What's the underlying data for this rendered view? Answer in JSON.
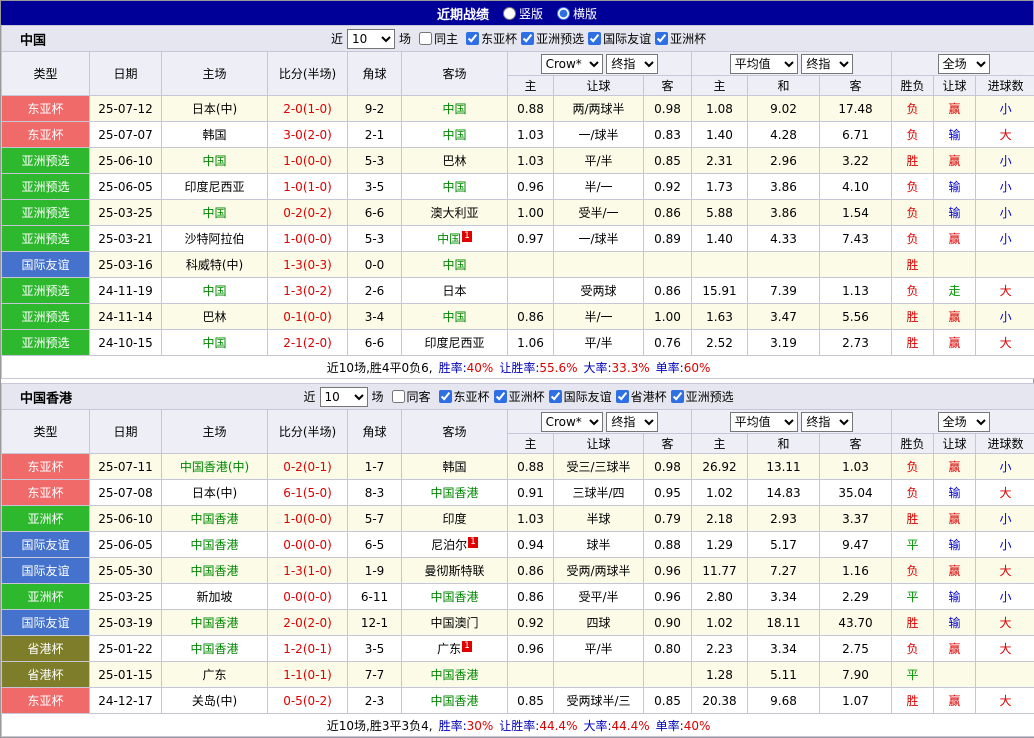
{
  "topbar": {
    "title": "近期战绩",
    "radio_vertical": "竖版",
    "radio_horizontal": "横版",
    "selected": "横版"
  },
  "columns": {
    "type": "类型",
    "date": "日期",
    "home": "主场",
    "score": "比分(半场)",
    "corner": "角球",
    "away": "客场",
    "odds_home": "主",
    "odds_hcap": "让球",
    "odds_away": "客",
    "eu_home": "主",
    "eu_draw": "和",
    "eu_away": "客",
    "wl": "胜负",
    "hcap_res": "让球",
    "goals": "进球数"
  },
  "controls": {
    "near_label": "近",
    "games_label": "场",
    "select_games": "10",
    "select_crow": "Crow*",
    "select_final1": "终指",
    "select_avg": "平均值",
    "select_final2": "终指",
    "select_full": "全场"
  },
  "colors": {
    "type": {
      "东亚杯": "#f16a6a",
      "亚洲预选": "#2eb82e",
      "国际友谊": "#4472cc",
      "亚洲杯": "#2eb82e",
      "省港杯": "#7d7d2a"
    },
    "result": {
      "胜": "#dd0000",
      "负": "#dd0000",
      "平": "#009900",
      "赢": "#dd0000",
      "输": "#0000cc",
      "走": "#009900",
      "大": "#dd0000",
      "小": "#0000cc"
    }
  },
  "sections": [
    {
      "title": "中国",
      "same_label": "同主",
      "same_checked": false,
      "filters": [
        "东亚杯",
        "亚洲预选",
        "国际友谊",
        "亚洲杯"
      ],
      "rows": [
        {
          "type": "东亚杯",
          "date": "25-07-12",
          "home": "日本(中)",
          "hf": false,
          "hs": "",
          "score": "2-0(1-0)",
          "corner": "9-2",
          "away": "中国",
          "af": true,
          "as": "",
          "oh": "0.88",
          "ohc": "两/两球半",
          "oa": "0.98",
          "eh": "1.08",
          "ed": "9.02",
          "ea": "17.48",
          "wl": "负",
          "hr": "赢",
          "gr": "小"
        },
        {
          "type": "东亚杯",
          "date": "25-07-07",
          "home": "韩国",
          "hf": false,
          "hs": "",
          "score": "3-0(2-0)",
          "corner": "2-1",
          "away": "中国",
          "af": true,
          "as": "",
          "oh": "1.03",
          "ohc": "一/球半",
          "oa": "0.83",
          "eh": "1.40",
          "ed": "4.28",
          "ea": "6.71",
          "wl": "负",
          "hr": "输",
          "gr": "大"
        },
        {
          "type": "亚洲预选",
          "date": "25-06-10",
          "home": "中国",
          "hf": true,
          "hs": "",
          "score": "1-0(0-0)",
          "corner": "5-3",
          "away": "巴林",
          "af": false,
          "as": "",
          "oh": "1.03",
          "ohc": "平/半",
          "oa": "0.85",
          "eh": "2.31",
          "ed": "2.96",
          "ea": "3.22",
          "wl": "胜",
          "hr": "赢",
          "gr": "小"
        },
        {
          "type": "亚洲预选",
          "date": "25-06-05",
          "home": "印度尼西亚",
          "hf": false,
          "hs": "",
          "score": "1-0(1-0)",
          "corner": "3-5",
          "away": "中国",
          "af": true,
          "as": "",
          "oh": "0.96",
          "ohc": "半/一",
          "oa": "0.92",
          "eh": "1.73",
          "ed": "3.86",
          "ea": "4.10",
          "wl": "负",
          "hr": "输",
          "gr": "小"
        },
        {
          "type": "亚洲预选",
          "date": "25-03-25",
          "home": "中国",
          "hf": true,
          "hs": "",
          "score": "0-2(0-2)",
          "corner": "6-6",
          "away": "澳大利亚",
          "af": false,
          "as": "",
          "oh": "1.00",
          "ohc": "受半/一",
          "oa": "0.86",
          "eh": "5.88",
          "ed": "3.86",
          "ea": "1.54",
          "wl": "负",
          "hr": "输",
          "gr": "小"
        },
        {
          "type": "亚洲预选",
          "date": "25-03-21",
          "home": "沙特阿拉伯",
          "hf": false,
          "hs": "",
          "score": "1-0(0-0)",
          "corner": "5-3",
          "away": "中国",
          "af": true,
          "as": "1",
          "oh": "0.97",
          "ohc": "一/球半",
          "oa": "0.89",
          "eh": "1.40",
          "ed": "4.33",
          "ea": "7.43",
          "wl": "负",
          "hr": "赢",
          "gr": "小"
        },
        {
          "type": "国际友谊",
          "date": "25-03-16",
          "home": "科威特(中)",
          "hf": false,
          "hs": "",
          "score": "1-3(0-3)",
          "corner": "0-0",
          "away": "中国",
          "af": true,
          "as": "",
          "oh": "",
          "ohc": "",
          "oa": "",
          "eh": "",
          "ed": "",
          "ea": "",
          "wl": "胜",
          "hr": "",
          "gr": ""
        },
        {
          "type": "亚洲预选",
          "date": "24-11-19",
          "home": "中国",
          "hf": true,
          "hs": "",
          "score": "1-3(0-2)",
          "corner": "2-6",
          "away": "日本",
          "af": false,
          "as": "",
          "oh": "",
          "ohc": "受两球",
          "oa": "0.86",
          "eh": "15.91",
          "ed": "7.39",
          "ea": "1.13",
          "wl": "负",
          "hr": "走",
          "gr": "大"
        },
        {
          "type": "亚洲预选",
          "date": "24-11-14",
          "home": "巴林",
          "hf": false,
          "hs": "",
          "score": "0-1(0-0)",
          "corner": "3-4",
          "away": "中国",
          "af": true,
          "as": "",
          "oh": "0.86",
          "ohc": "半/一",
          "oa": "1.00",
          "eh": "1.63",
          "ed": "3.47",
          "ea": "5.56",
          "wl": "胜",
          "hr": "赢",
          "gr": "小"
        },
        {
          "type": "亚洲预选",
          "date": "24-10-15",
          "home": "中国",
          "hf": true,
          "hs": "",
          "score": "2-1(2-0)",
          "corner": "6-6",
          "away": "印度尼西亚",
          "af": false,
          "as": "",
          "oh": "1.06",
          "ohc": "平/半",
          "oa": "0.76",
          "eh": "2.52",
          "ed": "3.19",
          "ea": "2.73",
          "wl": "胜",
          "hr": "赢",
          "gr": "大"
        }
      ],
      "summary": {
        "prefix": "近10场,胜4平0负6,",
        "stats": [
          {
            "label": "胜率:",
            "value": "40%"
          },
          {
            "label": "让胜率:",
            "value": "55.6%"
          },
          {
            "label": "大率:",
            "value": "33.3%"
          },
          {
            "label": "单率:",
            "value": "60%"
          }
        ]
      }
    },
    {
      "title": "中国香港",
      "same_label": "同客",
      "same_checked": false,
      "filters": [
        "东亚杯",
        "亚洲杯",
        "国际友谊",
        "省港杯",
        "亚洲预选"
      ],
      "rows": [
        {
          "type": "东亚杯",
          "date": "25-07-11",
          "home": "中国香港(中)",
          "hf": true,
          "hs": "",
          "score": "0-2(0-1)",
          "corner": "1-7",
          "away": "韩国",
          "af": false,
          "as": "",
          "oh": "0.88",
          "ohc": "受三/三球半",
          "oa": "0.98",
          "eh": "26.92",
          "ed": "13.11",
          "ea": "1.03",
          "wl": "负",
          "hr": "赢",
          "gr": "小"
        },
        {
          "type": "东亚杯",
          "date": "25-07-08",
          "home": "日本(中)",
          "hf": false,
          "hs": "",
          "score": "6-1(5-0)",
          "corner": "8-3",
          "away": "中国香港",
          "af": true,
          "as": "",
          "oh": "0.91",
          "ohc": "三球半/四",
          "oa": "0.95",
          "eh": "1.02",
          "ed": "14.83",
          "ea": "35.04",
          "wl": "负",
          "hr": "输",
          "gr": "大"
        },
        {
          "type": "亚洲杯",
          "date": "25-06-10",
          "home": "中国香港",
          "hf": true,
          "hs": "",
          "score": "1-0(0-0)",
          "corner": "5-7",
          "away": "印度",
          "af": false,
          "as": "",
          "oh": "1.03",
          "ohc": "半球",
          "oa": "0.79",
          "eh": "2.18",
          "ed": "2.93",
          "ea": "3.37",
          "wl": "胜",
          "hr": "赢",
          "gr": "小"
        },
        {
          "type": "国际友谊",
          "date": "25-06-05",
          "home": "中国香港",
          "hf": true,
          "hs": "",
          "score": "0-0(0-0)",
          "corner": "6-5",
          "away": "尼泊尔",
          "af": false,
          "as": "1",
          "oh": "0.94",
          "ohc": "球半",
          "oa": "0.88",
          "eh": "1.29",
          "ed": "5.17",
          "ea": "9.47",
          "wl": "平",
          "hr": "输",
          "gr": "小"
        },
        {
          "type": "国际友谊",
          "date": "25-05-30",
          "home": "中国香港",
          "hf": true,
          "hs": "",
          "score": "1-3(1-0)",
          "corner": "1-9",
          "away": "曼彻斯特联",
          "af": false,
          "as": "",
          "oh": "0.86",
          "ohc": "受两/两球半",
          "oa": "0.96",
          "eh": "11.77",
          "ed": "7.27",
          "ea": "1.16",
          "wl": "负",
          "hr": "赢",
          "gr": "大"
        },
        {
          "type": "亚洲杯",
          "date": "25-03-25",
          "home": "新加坡",
          "hf": false,
          "hs": "",
          "score": "0-0(0-0)",
          "corner": "6-11",
          "away": "中国香港",
          "af": true,
          "as": "",
          "oh": "0.86",
          "ohc": "受平/半",
          "oa": "0.96",
          "eh": "2.80",
          "ed": "3.34",
          "ea": "2.29",
          "wl": "平",
          "hr": "输",
          "gr": "小"
        },
        {
          "type": "国际友谊",
          "date": "25-03-19",
          "home": "中国香港",
          "hf": true,
          "hs": "",
          "score": "2-0(2-0)",
          "corner": "12-1",
          "away": "中国澳门",
          "af": false,
          "as": "",
          "oh": "0.92",
          "ohc": "四球",
          "oa": "0.90",
          "eh": "1.02",
          "ed": "18.11",
          "ea": "43.70",
          "wl": "胜",
          "hr": "输",
          "gr": "大"
        },
        {
          "type": "省港杯",
          "date": "25-01-22",
          "home": "中国香港",
          "hf": true,
          "hs": "",
          "score": "1-2(0-1)",
          "corner": "3-5",
          "away": "广东",
          "af": false,
          "as": "1",
          "oh": "0.96",
          "ohc": "平/半",
          "oa": "0.80",
          "eh": "2.23",
          "ed": "3.34",
          "ea": "2.75",
          "wl": "负",
          "hr": "赢",
          "gr": "大"
        },
        {
          "type": "省港杯",
          "date": "25-01-15",
          "home": "广东",
          "hf": false,
          "hs": "",
          "score": "1-1(0-1)",
          "corner": "7-7",
          "away": "中国香港",
          "af": true,
          "as": "",
          "oh": "",
          "ohc": "",
          "oa": "",
          "eh": "1.28",
          "ed": "5.11",
          "ea": "7.90",
          "wl": "平",
          "hr": "",
          "gr": ""
        },
        {
          "type": "东亚杯",
          "date": "24-12-17",
          "home": "关岛(中)",
          "hf": false,
          "hs": "",
          "score": "0-5(0-2)",
          "corner": "2-3",
          "away": "中国香港",
          "af": true,
          "as": "",
          "oh": "0.85",
          "ohc": "受两球半/三",
          "oa": "0.85",
          "eh": "20.38",
          "ed": "9.68",
          "ea": "1.07",
          "wl": "胜",
          "hr": "赢",
          "gr": "大"
        }
      ],
      "summary": {
        "prefix": "近10场,胜3平3负4,",
        "stats": [
          {
            "label": "胜率:",
            "value": "30%"
          },
          {
            "label": "让胜率:",
            "value": "44.4%"
          },
          {
            "label": "大率:",
            "value": "44.4%"
          },
          {
            "label": "单率:",
            "value": "40%"
          }
        ]
      }
    }
  ]
}
